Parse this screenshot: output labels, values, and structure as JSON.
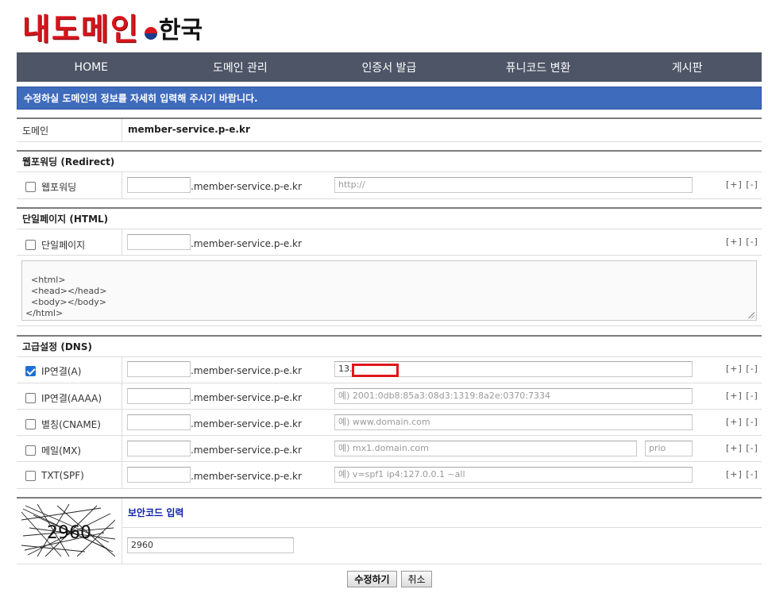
{
  "logo": {
    "main": "내도메인",
    "sub": "한국"
  },
  "nav": {
    "items": [
      "HOME",
      "도메인 관리",
      "인증서 발급",
      "퓨니코드 변환",
      "게시판"
    ]
  },
  "notice": "수정하실 도메인의 정보를 자세히 입력해 주시기 바랍니다.",
  "domain": {
    "label": "도메인",
    "value": "member-service.p-e.kr"
  },
  "suffix": ".member-service.p-e.kr",
  "pm": "[+] [-]",
  "redirect": {
    "title": "웹포워딩 (Redirect)",
    "label": "웹포워딩",
    "url_placeholder": "http://"
  },
  "html_page": {
    "title": "단일페이지 (HTML)",
    "label": "단일페이지",
    "content": "<html>\n  <head></head>\n  <body></body>\n</html>"
  },
  "dns": {
    "title": "고급설정 (DNS)",
    "rows": [
      {
        "label": "IP연결(A)",
        "checked": true,
        "value": "13.",
        "placeholder": ""
      },
      {
        "label": "IP연결(AAAA)",
        "checked": false,
        "value": "",
        "placeholder": "예) 2001:0db8:85a3:08d3:1319:8a2e:0370:7334"
      },
      {
        "label": "별칭(CNAME)",
        "checked": false,
        "value": "",
        "placeholder": "예) www.domain.com"
      },
      {
        "label": "메일(MX)",
        "checked": false,
        "value": "",
        "placeholder": "예) mx1.domain.com",
        "prio_placeholder": "prio"
      },
      {
        "label": "TXT(SPF)",
        "checked": false,
        "value": "",
        "placeholder": "예) v=spf1 ip4:127.0.0.1 ~all"
      }
    ]
  },
  "captcha": {
    "title": "보안코드 입력",
    "image_text": "2960",
    "input_value": "2960"
  },
  "buttons": {
    "submit": "수정하기",
    "cancel": "취소"
  },
  "colors": {
    "nav_bg": "#4d5566",
    "notice_bg": "#3f6bbd",
    "logo_red": "#d8141c",
    "captcha_title": "#0b1fa8"
  }
}
